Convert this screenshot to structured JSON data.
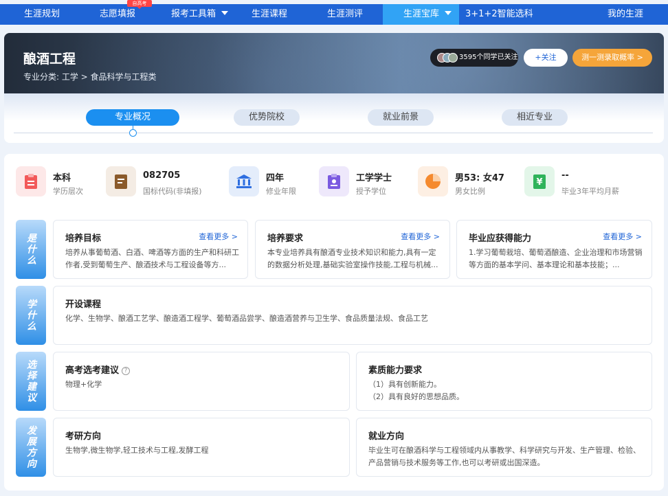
{
  "nav": {
    "items": [
      "生涯规划",
      "志愿填报",
      "报考工具箱",
      "生涯课程",
      "生涯测评",
      "生涯宝库",
      "3+1+2智能选科",
      "我的生涯"
    ],
    "badge": "自高考",
    "active": "生涯宝库"
  },
  "header": {
    "title": "酿酒工程",
    "category": "专业分类: 工学 > 食品科学与工程类",
    "follow_count": "3595个同学已关注",
    "follow_button": "+关注",
    "rate_button": "测一测录取概率 >"
  },
  "tabs": [
    "专业概况",
    "优势院校",
    "就业前景",
    "相近专业"
  ],
  "stats": [
    {
      "value": "本科",
      "label": "学历层次",
      "icon": "clipboard-icon",
      "color": "#f25a5a"
    },
    {
      "value": "082705",
      "label": "国标代码(非填报)",
      "icon": "document-icon",
      "color": "#8a5a2b"
    },
    {
      "value": "四年",
      "label": "修业年限",
      "icon": "building-icon",
      "color": "#2f6fe0"
    },
    {
      "value": "工学学士",
      "label": "授予学位",
      "icon": "badge-icon",
      "color": "#7a5ae0"
    },
    {
      "value": "男53: 女47",
      "label": "男女比例",
      "icon": "pie-chart-icon",
      "color": "#f58a2e"
    },
    {
      "value": "--",
      "label": "毕业3年平均月薪",
      "icon": "yuan-icon",
      "color": "#2fb35a"
    }
  ],
  "sections": {
    "what": {
      "label": "是什么",
      "cards": [
        {
          "title": "培养目标",
          "more": "查看更多 >",
          "body": "培养从事葡萄酒、白酒、啤酒等方面的生产和科研工作者,受到葡萄生产、酿酒技术与工程设备等方..."
        },
        {
          "title": "培养要求",
          "more": "查看更多 >",
          "body": "本专业培养具有酿酒专业技术知识和能力,具有一定的数据分析处理,基础实验室操作技能,工程与机械..."
        },
        {
          "title": "毕业应获得能力",
          "more": "查看更多 >",
          "body": "1.学习葡萄栽培、葡萄酒酿造、企业治理和市场营销等方面的基本学问、基本理论和基本技能；..."
        }
      ]
    },
    "learn": {
      "label": "学什么",
      "title": "开设课程",
      "body": "化学、生物学、酿酒工艺学、酿造酒工程学、葡萄酒品尝学、酿造酒营养与卫生学、食品质量法规、食品工艺"
    },
    "choose": {
      "label": "选择建议",
      "left": {
        "title": "高考选考建议",
        "help": "?",
        "body": "物理+化学"
      },
      "right": {
        "title": "素质能力要求",
        "lines": [
          "（1）具有创新能力。",
          "（2）具有良好的思想品质。"
        ]
      }
    },
    "develop": {
      "label": "发展方向",
      "left": {
        "title": "考研方向",
        "body": "生物学,微生物学,轻工技术与工程,发酵工程"
      },
      "right": {
        "title": "就业方向",
        "body": "毕业生可在酿酒科学与工程领域内从事教学、科学研究与开发、生产管理、检验、产品营销与技术服务等工作,也可以考研或出国深造。"
      }
    }
  }
}
